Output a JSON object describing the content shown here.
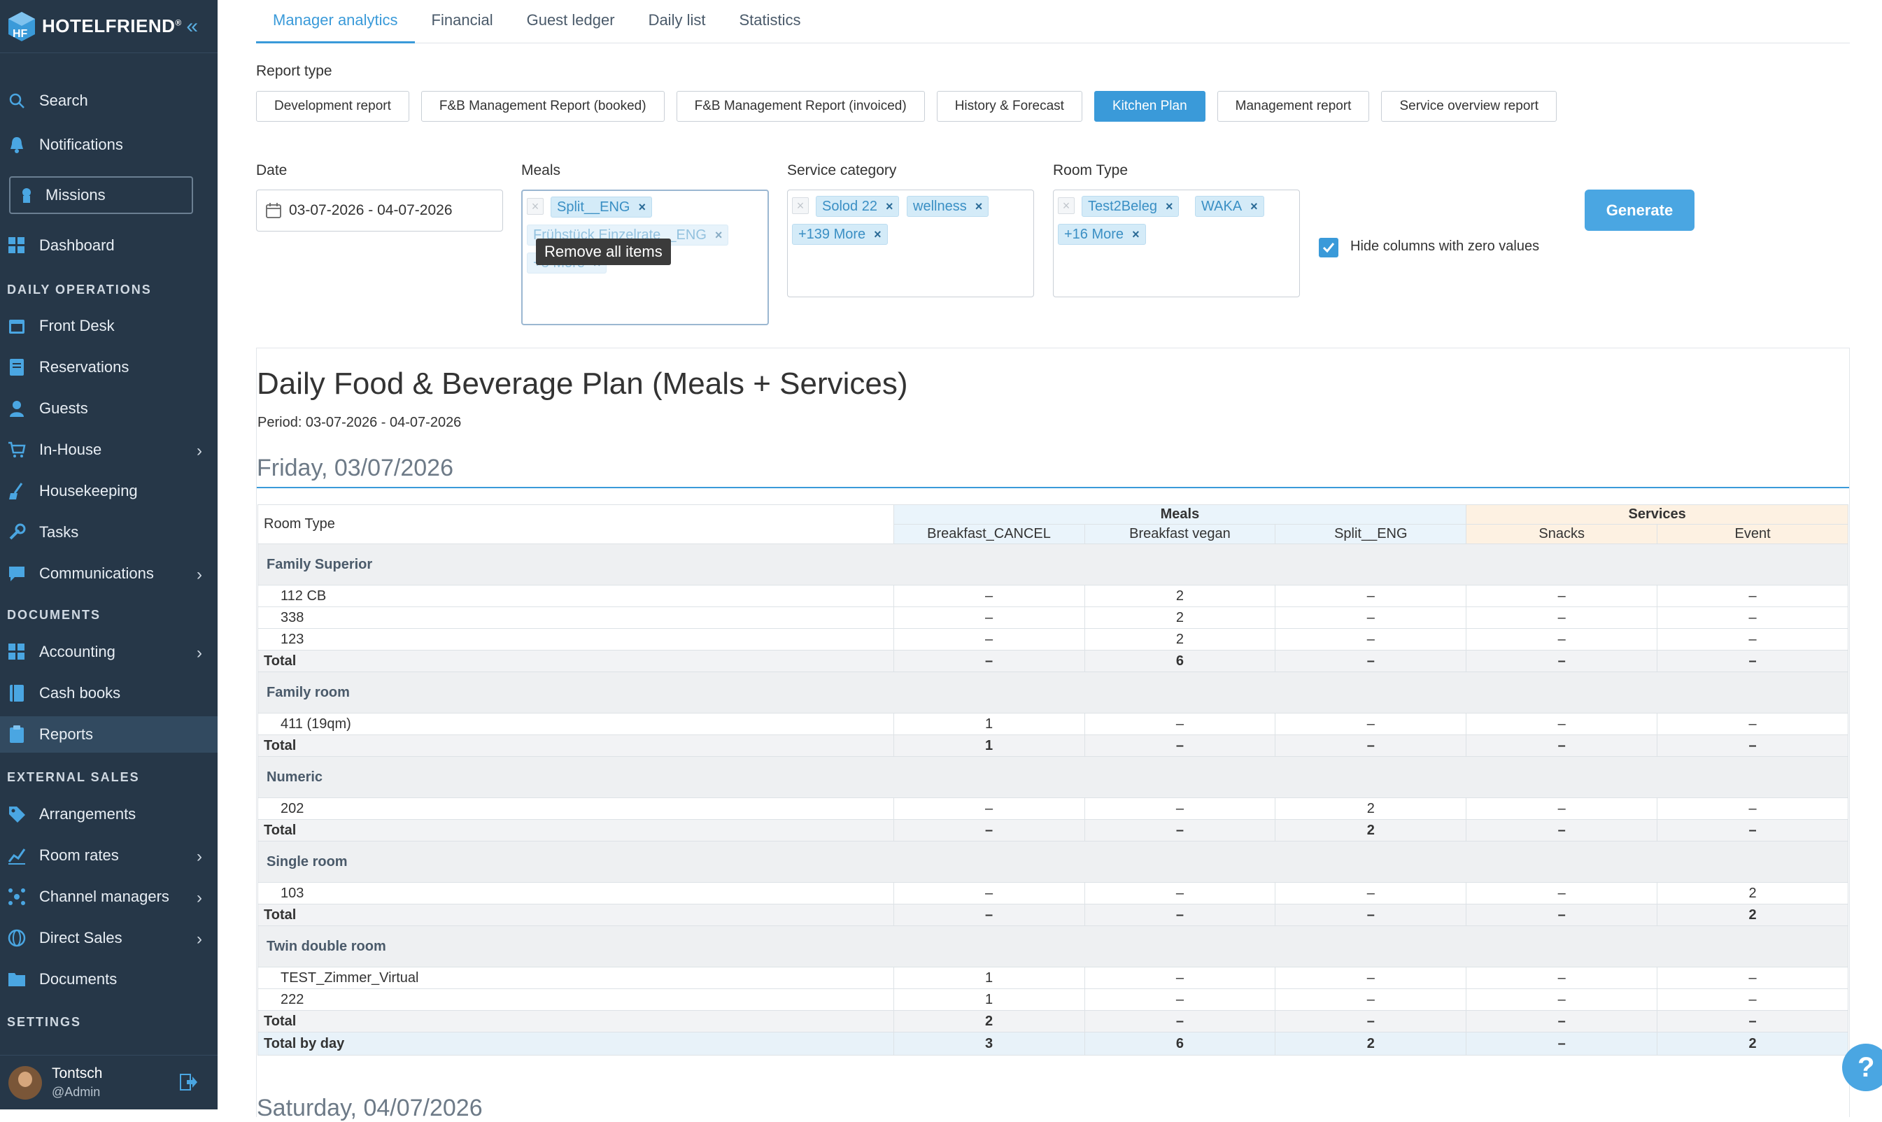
{
  "brand": {
    "name": "HOTELFRIEND",
    "mark": "®"
  },
  "sidebar": {
    "collapse_icon": "«",
    "search": "Search",
    "notifications": "Notifications",
    "missions": "Missions",
    "dashboard": "Dashboard",
    "section_daily": "DAILY OPERATIONS",
    "front_desk": "Front Desk",
    "reservations": "Reservations",
    "guests": "Guests",
    "in_house": "In-House",
    "housekeeping": "Housekeeping",
    "tasks": "Tasks",
    "communications": "Communications",
    "section_documents": "DOCUMENTS",
    "accounting": "Accounting",
    "cash_books": "Cash books",
    "reports": "Reports",
    "section_external": "EXTERNAL SALES",
    "arrangements": "Arrangements",
    "room_rates": "Room rates",
    "channel_managers": "Channel managers",
    "direct_sales": "Direct Sales",
    "documents": "Documents",
    "section_settings": "SETTINGS",
    "user_name": "Tontsch",
    "user_role": "@Admin"
  },
  "tabs": [
    "Manager analytics",
    "Financial",
    "Guest ledger",
    "Daily list",
    "Statistics"
  ],
  "report_type": {
    "label": "Report type",
    "buttons": [
      "Development report",
      "F&B Management Report (booked)",
      "F&B Management Report (invoiced)",
      "History & Forecast",
      "Kitchen Plan",
      "Management report",
      "Service overview report"
    ]
  },
  "filters": {
    "date_label": "Date",
    "date_value": "03-07-2026 - 04-07-2026",
    "meals_label": "Meals",
    "meals_chips": [
      "Split__ENG",
      "Frühstück Einzelrate__ENG",
      "+8 More"
    ],
    "tooltip": "Remove all items",
    "service_label": "Service category",
    "service_chips": [
      "Solod 22",
      "wellness",
      "+139 More"
    ],
    "room_label": "Room Type",
    "room_chips": [
      "Test2Beleg",
      "WAKA",
      "+16 More"
    ],
    "hide_zero": "Hide columns with zero values",
    "generate": "Generate"
  },
  "report": {
    "title": "Daily Food & Beverage Plan (Meals + Services)",
    "period": "Period: 03-07-2026 - 04-07-2026",
    "day1": "Friday, 03/07/2026",
    "day2": "Saturday, 04/07/2026",
    "col_room_type": "Room Type",
    "col_meals": "Meals",
    "col_services": "Services",
    "sub_cols": [
      "Breakfast_CANCEL",
      "Breakfast vegan",
      "Split__ENG",
      "Snacks",
      "Event"
    ],
    "total_label": "Total",
    "total_by_day_label": "Total by day",
    "groups": [
      {
        "name": "Family Superior",
        "rows": [
          {
            "room": "112 CB",
            "v": [
              "–",
              "2",
              "–",
              "–",
              "–"
            ]
          },
          {
            "room": "338",
            "v": [
              "–",
              "2",
              "–",
              "–",
              "–"
            ]
          },
          {
            "room": "123",
            "v": [
              "–",
              "2",
              "–",
              "–",
              "–"
            ]
          }
        ],
        "total": [
          "–",
          "6",
          "–",
          "–",
          "–"
        ]
      },
      {
        "name": "Family room",
        "rows": [
          {
            "room": "411 (19qm)",
            "v": [
              "1",
              "–",
              "–",
              "–",
              "–"
            ]
          }
        ],
        "total": [
          "1",
          "–",
          "–",
          "–",
          "–"
        ]
      },
      {
        "name": "Numeric",
        "rows": [
          {
            "room": "202",
            "v": [
              "–",
              "–",
              "2",
              "–",
              "–"
            ]
          }
        ],
        "total": [
          "–",
          "–",
          "2",
          "–",
          "–"
        ]
      },
      {
        "name": "Single room",
        "rows": [
          {
            "room": "103",
            "v": [
              "–",
              "–",
              "–",
              "–",
              "2"
            ]
          }
        ],
        "total": [
          "–",
          "–",
          "–",
          "–",
          "2"
        ]
      },
      {
        "name": "Twin double room",
        "rows": [
          {
            "room": "TEST_Zimmer_Virtual",
            "v": [
              "1",
              "–",
              "–",
              "–",
              "–"
            ]
          },
          {
            "room": "222",
            "v": [
              "1",
              "–",
              "–",
              "–",
              "–"
            ]
          }
        ],
        "total": [
          "2",
          "–",
          "–",
          "–",
          "–"
        ]
      }
    ],
    "total_by_day": [
      "3",
      "6",
      "2",
      "–",
      "2"
    ]
  },
  "help_label": "?",
  "colors": {
    "accent": "#3a9ad9",
    "sidebar": "#263748",
    "meals_header": "#eaf4fb",
    "services_header": "#fdf1e2"
  }
}
